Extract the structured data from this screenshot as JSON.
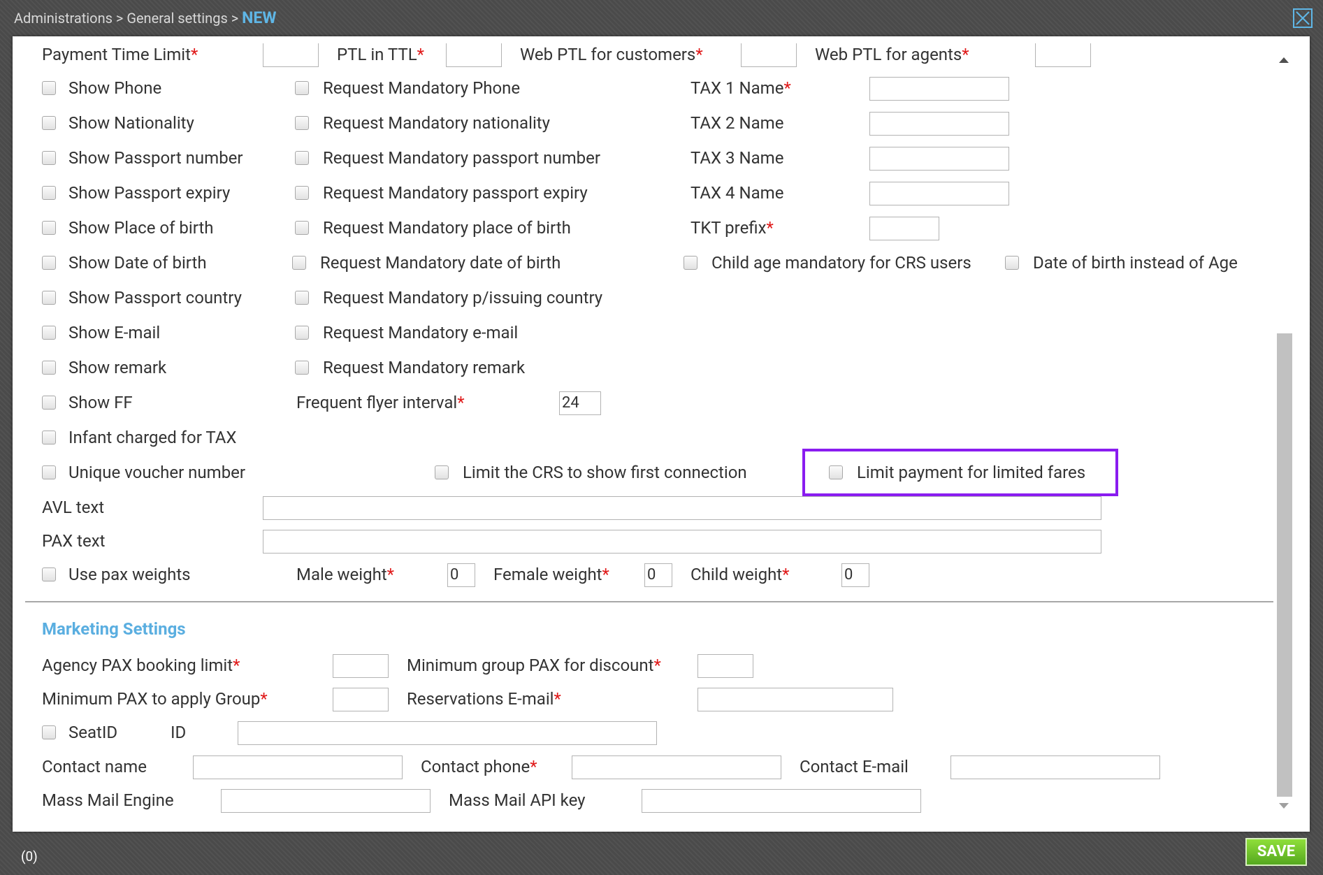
{
  "header": {
    "breadcrumb_prefix": "Administrations > General settings > ",
    "breadcrumb_current": "NEW"
  },
  "ptl": {
    "payment_time_limit": "Payment Time Limit",
    "ptl_in_ttl": "PTL in TTL",
    "web_ptl_customers": "Web PTL for customers",
    "web_ptl_agents": "Web PTL for agents"
  },
  "col1": {
    "show_phone": "Show Phone",
    "show_nationality": "Show Nationality",
    "show_passport_number": "Show Passport number",
    "show_passport_expiry": "Show Passport expiry",
    "show_place_of_birth": "Show Place of birth",
    "show_date_of_birth": "Show Date of birth",
    "show_passport_country": "Show Passport country",
    "show_email": "Show E-mail",
    "show_remark": "Show remark",
    "show_ff": "Show FF",
    "infant_charged": "Infant charged for TAX",
    "unique_voucher": "Unique voucher number"
  },
  "col2": {
    "req_phone": "Request Mandatory Phone",
    "req_nationality": "Request Mandatory nationality",
    "req_passport_number": "Request Mandatory passport number",
    "req_passport_expiry": "Request Mandatory passport expiry",
    "req_place_of_birth": "Request Mandatory place of birth",
    "req_date_of_birth": "Request Mandatory date of birth",
    "req_issuing_country": "Request Mandatory p/issuing country",
    "req_email": "Request Mandatory e-mail",
    "req_remark": "Request Mandatory remark",
    "ff_interval_label": "Frequent flyer interval",
    "ff_interval_value": "24",
    "limit_crs": "Limit the CRS to show first connection"
  },
  "col3": {
    "tax1": "TAX 1 Name",
    "tax2": "TAX 2 Name",
    "tax3": "TAX 3 Name",
    "tax4": "TAX 4 Name",
    "tkt_prefix": "TKT prefix",
    "child_age": "Child age mandatory for CRS users",
    "dob_instead_age": "Date of birth instead of Age",
    "limit_payment": "Limit payment for limited fares"
  },
  "texts": {
    "avl": "AVL text",
    "pax": "PAX text"
  },
  "weights": {
    "use_pax_weights": "Use pax weights",
    "male": "Male weight",
    "male_value": "0",
    "female": "Female weight",
    "female_value": "0",
    "child": "Child weight",
    "child_value": "0"
  },
  "marketing": {
    "title": "Marketing Settings",
    "agency_pax_limit": "Agency PAX booking limit",
    "min_group_pax": "Minimum group PAX for discount",
    "min_pax_group": "Minimum PAX to apply Group",
    "reservations_email": "Reservations E-mail",
    "seat_id": "SeatID",
    "id": "ID",
    "contact_name": "Contact name",
    "contact_phone": "Contact phone",
    "contact_email": "Contact E-mail",
    "mass_mail_engine": "Mass Mail Engine",
    "mass_mail_api_key": "Mass Mail API key"
  },
  "required_mark": "*",
  "footer": {
    "counter": "(0)",
    "save": "SAVE"
  },
  "colors": {
    "accent": "#5fb6e6",
    "required": "#e01b1b",
    "highlight": "#8a1cf0",
    "save_button": "#6cc329"
  },
  "icons": {
    "close": "close-icon",
    "scroll_up": "arrow-up-icon",
    "scroll_down": "arrow-down-icon"
  }
}
